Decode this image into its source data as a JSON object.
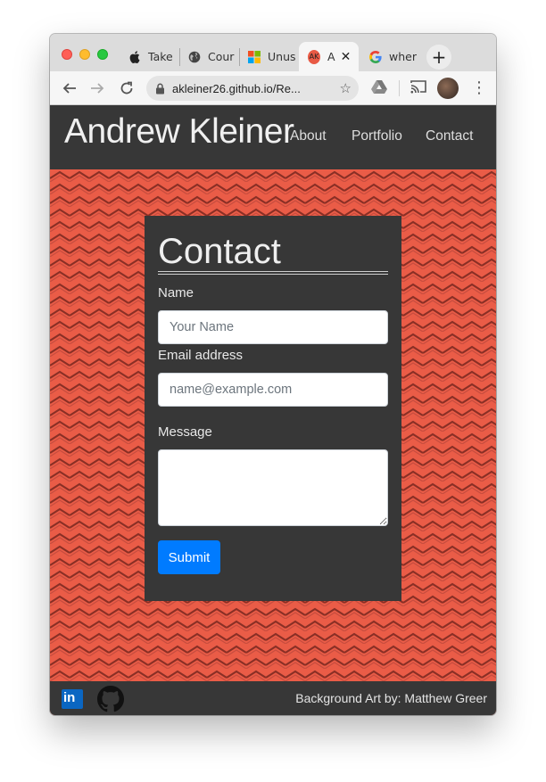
{
  "browser": {
    "tabs": [
      {
        "label": "Take",
        "icon": "apple-icon"
      },
      {
        "label": "Cour",
        "icon": "globe-icon"
      },
      {
        "label": "Unus",
        "icon": "microsoft-icon"
      },
      {
        "label": "A",
        "icon": "ak-favicon",
        "favicon_text": "AK",
        "active": true
      },
      {
        "label": "wher",
        "icon": "google-icon"
      }
    ],
    "new_tab_label": "+",
    "url": "akleiner26.github.io/Re..."
  },
  "site": {
    "brand": "Andrew Kleiner",
    "nav": [
      "About",
      "Portfolio",
      "Contact"
    ]
  },
  "contact": {
    "title": "Contact",
    "name_label": "Name",
    "name_placeholder": "Your Name",
    "email_label": "Email address",
    "email_placeholder": "name@example.com",
    "message_label": "Message",
    "submit_label": "Submit"
  },
  "footer": {
    "linkedin_text": "in",
    "credit": "Background Art by: Matthew Greer"
  },
  "colors": {
    "page_background": "#e85a45",
    "panel": "#373737",
    "accent": "#007bff"
  }
}
